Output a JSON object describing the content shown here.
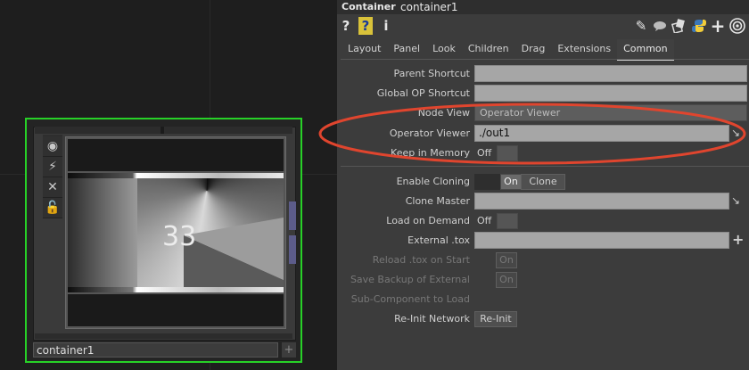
{
  "network": {
    "node_name": "container1",
    "viewer_number": "33",
    "node_icons": [
      "viewer-icon",
      "bypass-icon",
      "close-icon",
      "lock-icon"
    ],
    "add_symbol": "+"
  },
  "panel": {
    "op_type": "Container",
    "op_name": "container1",
    "toolbar_left": [
      "?",
      "?",
      "i"
    ],
    "toolbar_right": [
      "pencil-icon",
      "comment-icon",
      "clone-icon",
      "python-icon",
      "plus-icon",
      "target-icon"
    ],
    "tabs": [
      "Layout",
      "Panel",
      "Look",
      "Children",
      "Drag",
      "Extensions",
      "Common"
    ],
    "active_tab": "Common",
    "params": {
      "parent_shortcut": {
        "label": "Parent Shortcut",
        "value": ""
      },
      "global_op_shortcut": {
        "label": "Global OP Shortcut",
        "value": ""
      },
      "node_view": {
        "label": "Node View",
        "value": "Operator Viewer"
      },
      "operator_viewer": {
        "label": "Operator Viewer",
        "value": "./out1"
      },
      "keep_in_memory": {
        "label": "Keep in Memory",
        "value": "Off"
      },
      "enable_cloning": {
        "label": "Enable Cloning",
        "value": "On",
        "button": "Clone"
      },
      "clone_master": {
        "label": "Clone Master",
        "value": ""
      },
      "load_on_demand": {
        "label": "Load on Demand",
        "value": "Off"
      },
      "external_tox": {
        "label": "External .tox",
        "value": ""
      },
      "reload_tox": {
        "label": "Reload .tox on Start",
        "value": "On"
      },
      "save_backup": {
        "label": "Save Backup of External",
        "value": "On"
      },
      "sub_component": {
        "label": "Sub-Component to Load"
      },
      "reinit_network": {
        "label": "Re-Init Network",
        "button": "Re-Init"
      }
    },
    "annotation_color": "#e0452e"
  }
}
